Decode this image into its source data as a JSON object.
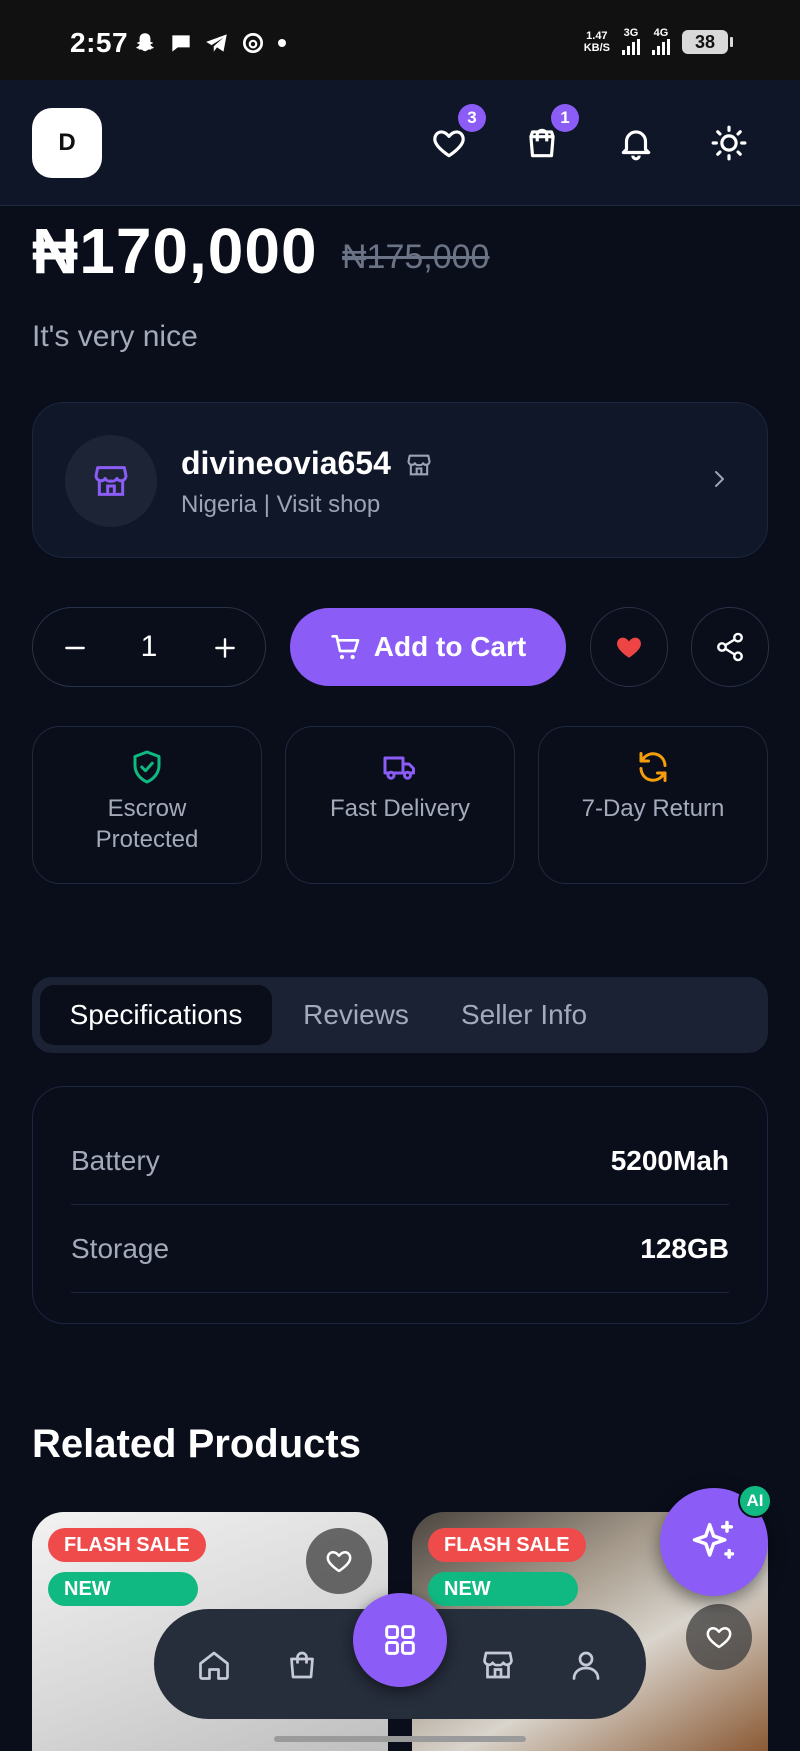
{
  "status_bar": {
    "time": "2:57",
    "net_speed_value": "1.47",
    "net_speed_unit": "KB/S",
    "network_1": "3G",
    "network_2": "4G",
    "battery": "38"
  },
  "header": {
    "avatar_initial": "D",
    "wishlist_count": "3",
    "cart_count": "1"
  },
  "product": {
    "price": "₦170,000",
    "old_price": "₦175,000",
    "description": "It's very nice"
  },
  "seller": {
    "name": "divineovia654",
    "subtitle": "Nigeria | Visit shop"
  },
  "actions": {
    "quantity": "1",
    "add_to_cart_label": "Add to Cart"
  },
  "features": [
    {
      "label": "Escrow Protected",
      "icon": "shield-check-icon",
      "color": "#10b981"
    },
    {
      "label": "Fast Delivery",
      "icon": "truck-icon",
      "color": "#8b5cf6"
    },
    {
      "label": "7-Day Return",
      "icon": "refresh-icon",
      "color": "#f59e0b"
    }
  ],
  "tabs": [
    {
      "label": "Specifications",
      "active": true
    },
    {
      "label": "Reviews",
      "active": false
    },
    {
      "label": "Seller Info",
      "active": false
    }
  ],
  "specifications": [
    {
      "key": "Battery",
      "value": "5200Mah"
    },
    {
      "key": "Storage",
      "value": "128GB"
    }
  ],
  "related": {
    "title": "Related Products",
    "items": [
      {
        "flash_tag": "FLASH SALE",
        "new_tag": "NEW"
      },
      {
        "flash_tag": "FLASH SALE",
        "new_tag": "NEW"
      }
    ]
  },
  "ai_fab": {
    "badge": "AI"
  },
  "colors": {
    "accent": "#8b5cf6",
    "background": "#0a0e1a",
    "flash_sale": "#ef4b4b",
    "new_tag": "#10b981",
    "heart": "#ef4444"
  }
}
